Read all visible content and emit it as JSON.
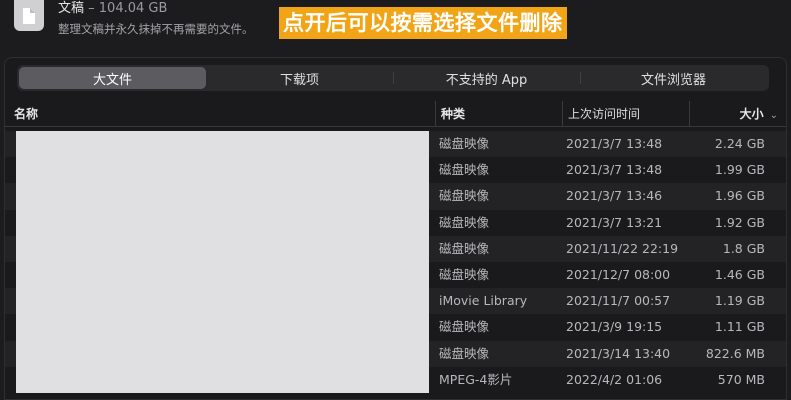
{
  "header": {
    "category_name": "文稿",
    "category_size": "– 104.04 GB",
    "subtitle": "整理文稿并永久抹掉不再需要的文件。",
    "annotation": "点开后可以按需选择文件删除"
  },
  "tabs": [
    {
      "label": "大文件",
      "active": true
    },
    {
      "label": "下载项",
      "active": false
    },
    {
      "label": "不支持的 App",
      "active": false
    },
    {
      "label": "文件浏览器",
      "active": false
    }
  ],
  "columns": {
    "name": "名称",
    "kind": "种类",
    "last_opened": "上次访问时间",
    "size": "大小"
  },
  "rows": [
    {
      "kind": "磁盘映像",
      "date": "2021/3/7 13:48",
      "size": "2.24 GB"
    },
    {
      "kind": "磁盘映像",
      "date": "2021/3/7 13:48",
      "size": "1.99 GB"
    },
    {
      "kind": "磁盘映像",
      "date": "2021/3/7 13:46",
      "size": "1.96 GB"
    },
    {
      "kind": "磁盘映像",
      "date": "2021/3/7 13:21",
      "size": "1.92 GB"
    },
    {
      "kind": "磁盘映像",
      "date": "2021/11/22 22:19",
      "size": "1.8 GB"
    },
    {
      "kind": "磁盘映像",
      "date": "2021/12/7 08:00",
      "size": "1.46 GB"
    },
    {
      "kind": "iMovie Library",
      "date": "2021/11/7 00:57",
      "size": "1.19 GB"
    },
    {
      "kind": "磁盘映像",
      "date": "2021/3/9 19:15",
      "size": "1.11 GB"
    },
    {
      "kind": "磁盘映像",
      "date": "2021/3/14 13:40",
      "size": "822.6 MB"
    },
    {
      "kind": "MPEG-4影片",
      "date": "2022/4/2 01:06",
      "size": "570 MB"
    }
  ]
}
